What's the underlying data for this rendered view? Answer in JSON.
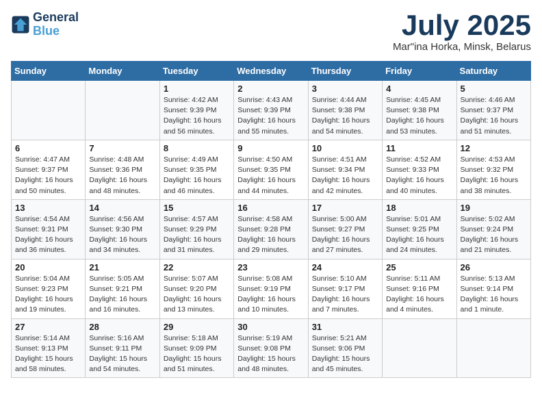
{
  "header": {
    "logo_line1": "General",
    "logo_line2": "Blue",
    "month_year": "July 2025",
    "location": "Mar\"ina Horka, Minsk, Belarus"
  },
  "days_of_week": [
    "Sunday",
    "Monday",
    "Tuesday",
    "Wednesday",
    "Thursday",
    "Friday",
    "Saturday"
  ],
  "weeks": [
    [
      {
        "day": "",
        "text": ""
      },
      {
        "day": "",
        "text": ""
      },
      {
        "day": "1",
        "text": "Sunrise: 4:42 AM\nSunset: 9:39 PM\nDaylight: 16 hours and 56 minutes."
      },
      {
        "day": "2",
        "text": "Sunrise: 4:43 AM\nSunset: 9:39 PM\nDaylight: 16 hours and 55 minutes."
      },
      {
        "day": "3",
        "text": "Sunrise: 4:44 AM\nSunset: 9:38 PM\nDaylight: 16 hours and 54 minutes."
      },
      {
        "day": "4",
        "text": "Sunrise: 4:45 AM\nSunset: 9:38 PM\nDaylight: 16 hours and 53 minutes."
      },
      {
        "day": "5",
        "text": "Sunrise: 4:46 AM\nSunset: 9:37 PM\nDaylight: 16 hours and 51 minutes."
      }
    ],
    [
      {
        "day": "6",
        "text": "Sunrise: 4:47 AM\nSunset: 9:37 PM\nDaylight: 16 hours and 50 minutes."
      },
      {
        "day": "7",
        "text": "Sunrise: 4:48 AM\nSunset: 9:36 PM\nDaylight: 16 hours and 48 minutes."
      },
      {
        "day": "8",
        "text": "Sunrise: 4:49 AM\nSunset: 9:35 PM\nDaylight: 16 hours and 46 minutes."
      },
      {
        "day": "9",
        "text": "Sunrise: 4:50 AM\nSunset: 9:35 PM\nDaylight: 16 hours and 44 minutes."
      },
      {
        "day": "10",
        "text": "Sunrise: 4:51 AM\nSunset: 9:34 PM\nDaylight: 16 hours and 42 minutes."
      },
      {
        "day": "11",
        "text": "Sunrise: 4:52 AM\nSunset: 9:33 PM\nDaylight: 16 hours and 40 minutes."
      },
      {
        "day": "12",
        "text": "Sunrise: 4:53 AM\nSunset: 9:32 PM\nDaylight: 16 hours and 38 minutes."
      }
    ],
    [
      {
        "day": "13",
        "text": "Sunrise: 4:54 AM\nSunset: 9:31 PM\nDaylight: 16 hours and 36 minutes."
      },
      {
        "day": "14",
        "text": "Sunrise: 4:56 AM\nSunset: 9:30 PM\nDaylight: 16 hours and 34 minutes."
      },
      {
        "day": "15",
        "text": "Sunrise: 4:57 AM\nSunset: 9:29 PM\nDaylight: 16 hours and 31 minutes."
      },
      {
        "day": "16",
        "text": "Sunrise: 4:58 AM\nSunset: 9:28 PM\nDaylight: 16 hours and 29 minutes."
      },
      {
        "day": "17",
        "text": "Sunrise: 5:00 AM\nSunset: 9:27 PM\nDaylight: 16 hours and 27 minutes."
      },
      {
        "day": "18",
        "text": "Sunrise: 5:01 AM\nSunset: 9:25 PM\nDaylight: 16 hours and 24 minutes."
      },
      {
        "day": "19",
        "text": "Sunrise: 5:02 AM\nSunset: 9:24 PM\nDaylight: 16 hours and 21 minutes."
      }
    ],
    [
      {
        "day": "20",
        "text": "Sunrise: 5:04 AM\nSunset: 9:23 PM\nDaylight: 16 hours and 19 minutes."
      },
      {
        "day": "21",
        "text": "Sunrise: 5:05 AM\nSunset: 9:21 PM\nDaylight: 16 hours and 16 minutes."
      },
      {
        "day": "22",
        "text": "Sunrise: 5:07 AM\nSunset: 9:20 PM\nDaylight: 16 hours and 13 minutes."
      },
      {
        "day": "23",
        "text": "Sunrise: 5:08 AM\nSunset: 9:19 PM\nDaylight: 16 hours and 10 minutes."
      },
      {
        "day": "24",
        "text": "Sunrise: 5:10 AM\nSunset: 9:17 PM\nDaylight: 16 hours and 7 minutes."
      },
      {
        "day": "25",
        "text": "Sunrise: 5:11 AM\nSunset: 9:16 PM\nDaylight: 16 hours and 4 minutes."
      },
      {
        "day": "26",
        "text": "Sunrise: 5:13 AM\nSunset: 9:14 PM\nDaylight: 16 hours and 1 minute."
      }
    ],
    [
      {
        "day": "27",
        "text": "Sunrise: 5:14 AM\nSunset: 9:13 PM\nDaylight: 15 hours and 58 minutes."
      },
      {
        "day": "28",
        "text": "Sunrise: 5:16 AM\nSunset: 9:11 PM\nDaylight: 15 hours and 54 minutes."
      },
      {
        "day": "29",
        "text": "Sunrise: 5:18 AM\nSunset: 9:09 PM\nDaylight: 15 hours and 51 minutes."
      },
      {
        "day": "30",
        "text": "Sunrise: 5:19 AM\nSunset: 9:08 PM\nDaylight: 15 hours and 48 minutes."
      },
      {
        "day": "31",
        "text": "Sunrise: 5:21 AM\nSunset: 9:06 PM\nDaylight: 15 hours and 45 minutes."
      },
      {
        "day": "",
        "text": ""
      },
      {
        "day": "",
        "text": ""
      }
    ]
  ]
}
